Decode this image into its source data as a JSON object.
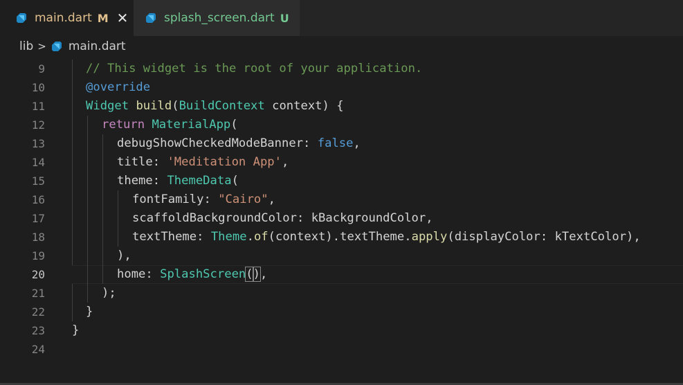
{
  "tabs": [
    {
      "name": "main.dart",
      "status": "M",
      "close": "✕",
      "icon": "dart-icon"
    },
    {
      "name": "splash_screen.dart",
      "status": "U",
      "icon": "dart-icon"
    }
  ],
  "breadcrumb": {
    "folder": "lib",
    "separator": ">",
    "file": "main.dart"
  },
  "colors": {
    "editor_bg": "#1e1e1e",
    "tabbar_bg": "#252526",
    "modified": "#e2c08d",
    "untracked": "#73c991",
    "comment": "#6a9955",
    "keyword": "#569cd6",
    "control": "#c586c0",
    "type": "#4ec9b0",
    "function": "#dcdcaa",
    "string": "#ce9178"
  },
  "editor": {
    "current_line": 20,
    "line_numbers": [
      "9",
      "10",
      "11",
      "12",
      "13",
      "14",
      "15",
      "16",
      "17",
      "18",
      "19",
      "20",
      "21",
      "22",
      "23",
      "24"
    ],
    "tokens": {
      "l9_comment": "// This widget is the root of your application.",
      "l10_annotation": "@override",
      "l11_type": "Widget",
      "l11_fn": "build",
      "l11_paren_open": "(",
      "l11_param_type": "BuildContext",
      "l11_param": " context",
      "l11_close": ") {",
      "l12_return": "return",
      "l12_type": "MaterialApp",
      "l12_paren": "(",
      "l13_prop": "debugShowCheckedModeBanner: ",
      "l13_value": "false",
      "l13_comma": ",",
      "l14_prop": "title: ",
      "l14_value": "'Meditation App'",
      "l14_comma": ",",
      "l15_prop": "theme: ",
      "l15_type": "ThemeData",
      "l15_paren": "(",
      "l16_prop": "fontFamily: ",
      "l16_value": "\"Cairo\"",
      "l16_comma": ",",
      "l17_prop": "scaffoldBackgroundColor: kBackgroundColor,",
      "l18_prop": "textTheme: ",
      "l18_type": "Theme",
      "l18_dot1": ".",
      "l18_fn1": "of",
      "l18_mid": "(context).textTheme.",
      "l18_fn2": "apply",
      "l18_end": "(displayColor: kTextColor),",
      "l19_close": "),",
      "l20_prop": "home: ",
      "l20_type": "SplashScreen",
      "l20_open": "(",
      "l20_close": ")",
      "l20_comma": ",",
      "l21_close": ");",
      "l22_close": "}",
      "l23_close": "}"
    }
  }
}
